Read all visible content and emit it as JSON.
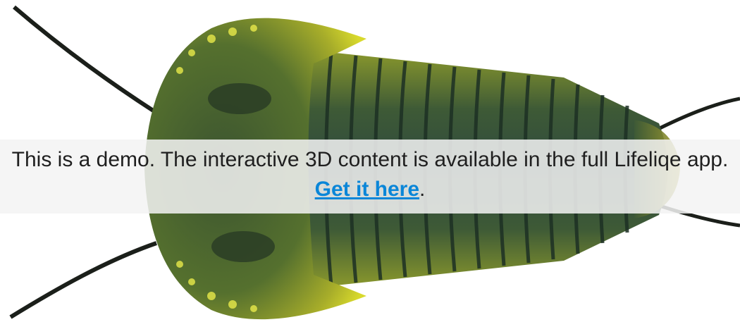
{
  "demo_notice": {
    "message": "This is a demo. The interactive 3D content is available in the full Lifeliqe app.",
    "link_label": "Get it here",
    "trailing": "."
  },
  "viewer": {
    "model_icon": "trilobite-3d-model",
    "colors": {
      "shell": "#3f5a2c",
      "shell_highlight": "#c9cc2a",
      "segments": "#2e4a34",
      "antenna": "#1b1f1a",
      "link": "#0a86d8",
      "overlay": "#f3f3f3"
    }
  }
}
